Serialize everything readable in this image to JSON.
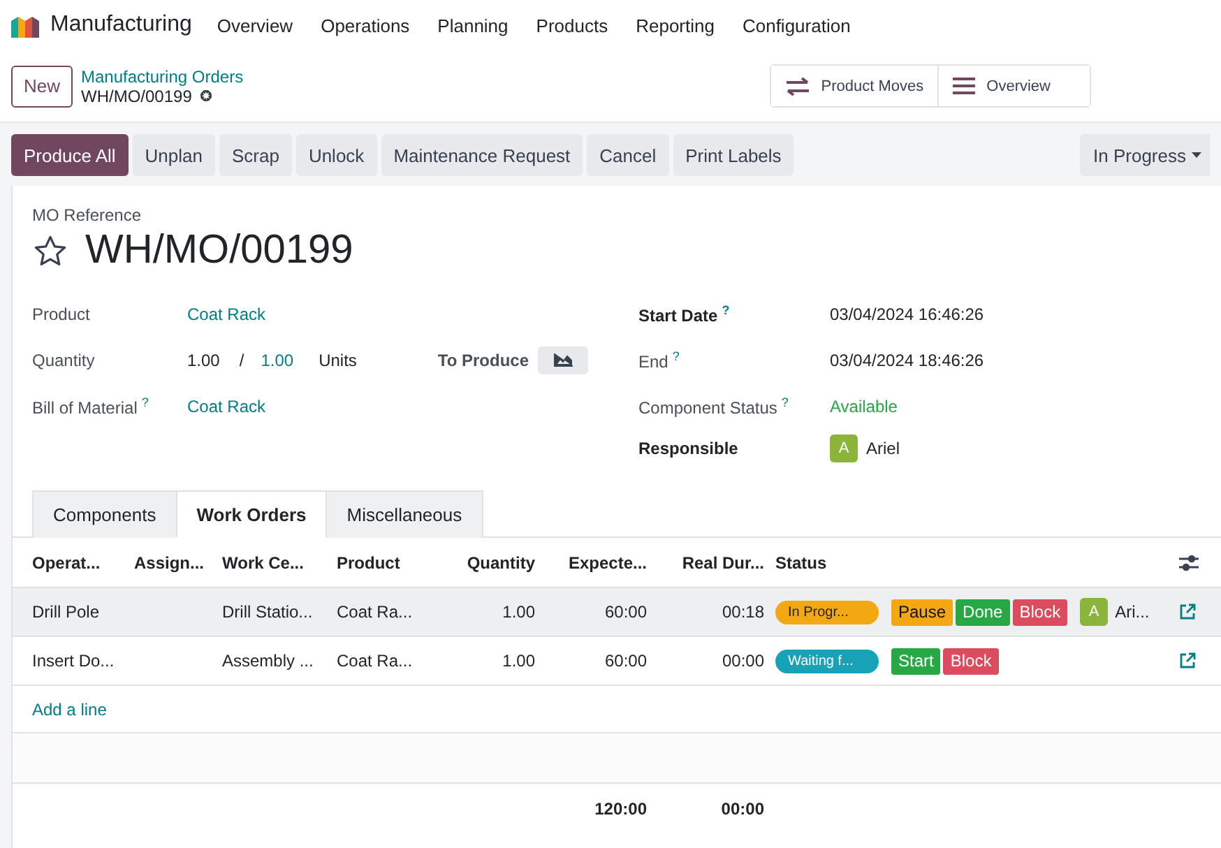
{
  "navbar": {
    "app_name": "Manufacturing",
    "menu": [
      "Overview",
      "Operations",
      "Planning",
      "Products",
      "Reporting",
      "Configuration"
    ]
  },
  "control_panel": {
    "new_button": "New",
    "breadcrumb": "Manufacturing Orders",
    "record": "WH/MO/00199",
    "smart_buttons": [
      {
        "label": "Product Moves",
        "kind": "moves"
      },
      {
        "label": "Overview",
        "kind": "list"
      }
    ]
  },
  "action_buttons": [
    {
      "label": "Produce All",
      "kind": "primary"
    },
    {
      "label": "Unplan",
      "kind": "secondary"
    },
    {
      "label": "Scrap",
      "kind": "secondary"
    },
    {
      "label": "Unlock",
      "kind": "secondary"
    },
    {
      "label": "Maintenance Request",
      "kind": "secondary"
    },
    {
      "label": "Cancel",
      "kind": "secondary"
    },
    {
      "label": "Print Labels",
      "kind": "secondary"
    }
  ],
  "status": "In Progress",
  "form": {
    "reference_label": "MO Reference",
    "reference": "WH/MO/00199",
    "starred": false,
    "left_fields": [
      {
        "label": "Product",
        "kind": "link",
        "value": "Coat Rack"
      },
      {
        "label": "Quantity",
        "kind": "quantity",
        "produced": "1.00",
        "separator": "/",
        "planned": "1.00",
        "unit": "Units",
        "action_label": "To Produce"
      },
      {
        "label": "Bill of Material",
        "help": "?",
        "kind": "link",
        "value": "Coat Rack"
      }
    ],
    "right_fields": [
      {
        "label": "Start Date",
        "help": "?",
        "bold": true,
        "kind": "text",
        "value": "03/04/2024 16:46:26"
      },
      {
        "label": "End",
        "help": "?",
        "bold": false,
        "kind": "text",
        "value": "03/04/2024 18:46:26"
      },
      {
        "label": "Component Status",
        "help": "?",
        "bold": false,
        "kind": "success",
        "value": "Available"
      },
      {
        "label": "Responsible",
        "bold": true,
        "kind": "user",
        "avatar": "A",
        "color": "#8bb43a",
        "value": "Ariel"
      }
    ]
  },
  "tabs": [
    {
      "label": "Components",
      "selected": false
    },
    {
      "label": "Work Orders",
      "selected": true
    },
    {
      "label": "Miscellaneous",
      "selected": false
    }
  ],
  "table": {
    "columns": [
      "Operat...",
      "Assign...",
      "Work Ce...",
      "Product",
      "Quantity",
      "Expecte...",
      "Real Dur...",
      "Status"
    ],
    "rows": [
      {
        "selected": true,
        "operation": "Drill Pole",
        "work_center": "Drill Statio...",
        "product": "Coat Ra...",
        "quantity": "1.00",
        "expected": "60:00",
        "real": "00:18",
        "status": "In Progr...",
        "color": "#f3a712",
        "buttons": [
          {
            "label": "Pause",
            "kind": "warning"
          },
          {
            "label": "Done",
            "kind": "success"
          },
          {
            "label": "Block",
            "kind": "danger"
          }
        ],
        "user": {
          "avatar": "A",
          "name": "Ari...",
          "color": "#8bb43a"
        }
      },
      {
        "selected": false,
        "operation": "Insert Do...",
        "work_center": "Assembly ...",
        "product": "Coat Ra...",
        "quantity": "1.00",
        "expected": "60:00",
        "real": "00:00",
        "status": "Waiting f...",
        "color": "#17a2b8",
        "buttons": [
          {
            "label": "Start",
            "kind": "success"
          },
          {
            "label": "Block",
            "kind": "danger"
          }
        ]
      }
    ],
    "add_line": "Add a line",
    "totals": {
      "expected": "120:00",
      "real": "00:00"
    }
  }
}
